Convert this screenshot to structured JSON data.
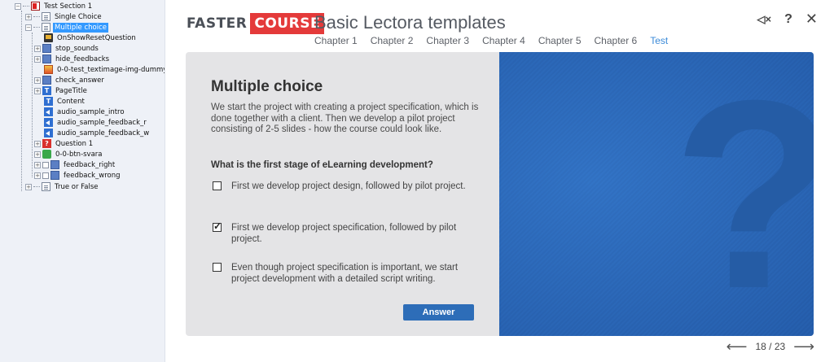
{
  "tree": {
    "items": [
      {
        "label": "Test Section 1",
        "icon": "section-icon"
      },
      {
        "label": "Single Choice",
        "icon": "page-icon"
      },
      {
        "label": "Multiple choice",
        "icon": "page-icon",
        "selected": true
      },
      {
        "label": "OnShowResetQuestion",
        "icon": "action-icon"
      },
      {
        "label": "stop_sounds",
        "icon": "group-icon"
      },
      {
        "label": "hide_feedbacks",
        "icon": "group-icon"
      },
      {
        "label": "0-0-test_textimage-img-dummy",
        "icon": "image-icon"
      },
      {
        "label": "check_answer",
        "icon": "group-icon"
      },
      {
        "label": "PageTitle",
        "icon": "text-icon"
      },
      {
        "label": "Content",
        "icon": "text-icon"
      },
      {
        "label": "audio_sample_intro",
        "icon": "audio-icon"
      },
      {
        "label": "audio_sample_feedback_r",
        "icon": "audio-icon"
      },
      {
        "label": "audio_sample_feedback_w",
        "icon": "audio-icon"
      },
      {
        "label": "Question 1",
        "icon": "question-icon"
      },
      {
        "label": "0-0-btn-svara",
        "icon": "button-icon"
      },
      {
        "label": "feedback_right",
        "icon": "group-icon"
      },
      {
        "label": "feedback_wrong",
        "icon": "group-icon"
      },
      {
        "label": "True or False",
        "icon": "page-icon"
      }
    ]
  },
  "header": {
    "logo_left": "FASTER",
    "logo_right": "COURSE",
    "title": "Basic Lectora templates",
    "chapters": [
      "Chapter 1",
      "Chapter 2",
      "Chapter 3",
      "Chapter 4",
      "Chapter 5",
      "Chapter 6",
      "Test"
    ],
    "active_chapter": "Test",
    "controls": {
      "mute": "◁×",
      "help": "?",
      "close": "✕"
    }
  },
  "slide": {
    "title": "Multiple choice",
    "intro": "We start the project with creating a project specification, which is done together with a client. Then we develop a pilot project consisting of 2-5 slides - how the course could look like.",
    "question": "What is the first stage of eLearning development?",
    "options": [
      {
        "text": "First we develop project design, followed by pilot project.",
        "checked": false
      },
      {
        "text": "First we develop project specification, followed by pilot project.",
        "checked": true
      },
      {
        "text": "Even though project specification is important, we start project development with a detailed script writing.",
        "checked": false
      }
    ],
    "answer_label": "Answer",
    "decor_glyph": "?"
  },
  "footer": {
    "prev": "⟵",
    "page_label": "18 / 23",
    "next": "⟶"
  },
  "colors": {
    "brand_red": "#e43a3a",
    "accent_blue": "#3b8ad8",
    "button_blue": "#2d6db8",
    "image_blue": "#2a67b8",
    "selection_blue": "#3399ff"
  }
}
